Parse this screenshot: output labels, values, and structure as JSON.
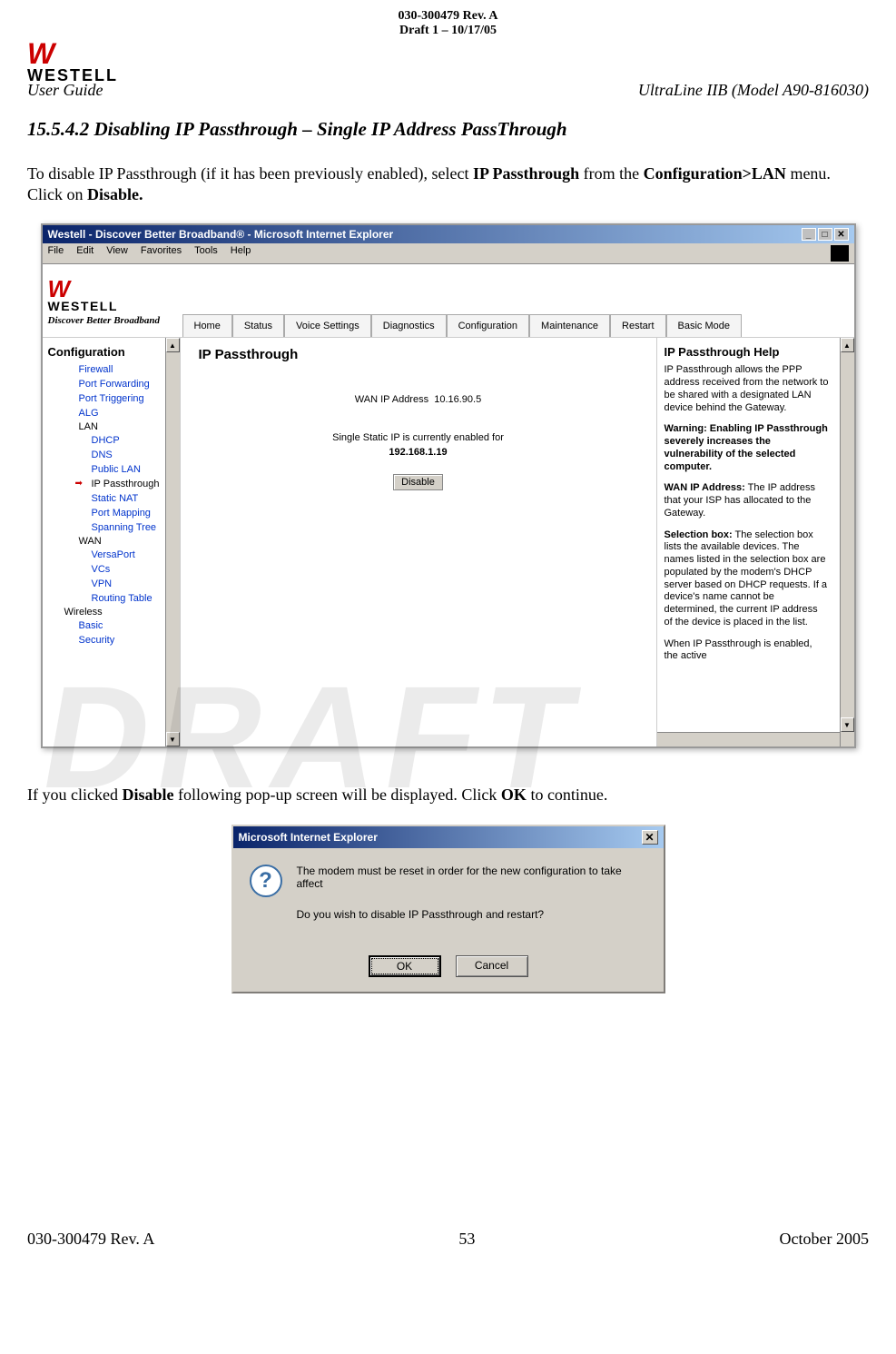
{
  "header": {
    "doc_rev": "030-300479 Rev. A",
    "draft": "Draft 1 – 10/17/05",
    "user_guide": "User Guide",
    "product": "UltraLine IIB (Model A90-816030)",
    "logo_text": "WESTELL"
  },
  "section": {
    "number": "15.5.4.2",
    "title": "Disabling IP Passthrough – Single IP Address PassThrough"
  },
  "para1_a": "To disable IP Passthrough (if it has been previously enabled), select ",
  "para1_b": "IP Passthrough",
  "para1_c": " from the ",
  "para1_d": "Configuration>LAN",
  "para1_e": " menu. Click on ",
  "para1_f": "Disable.",
  "para2_a": "If you clicked ",
  "para2_b": "Disable",
  "para2_c": " following pop-up screen will be displayed. Click ",
  "para2_d": "OK",
  "para2_e": " to continue.",
  "browser": {
    "title": "Westell - Discover Better Broadband® - Microsoft Internet Explorer",
    "menu": [
      "File",
      "Edit",
      "View",
      "Favorites",
      "Tools",
      "Help"
    ],
    "tagline": "Discover Better Broadband",
    "tabs": [
      "Home",
      "Status",
      "Voice Settings",
      "Diagnostics",
      "Configuration",
      "Maintenance",
      "Restart",
      "Basic Mode"
    ],
    "sidebar_title": "Configuration",
    "sidebar": {
      "top": [
        "Firewall",
        "Port Forwarding",
        "Port Triggering",
        "ALG"
      ],
      "lan_label": "LAN",
      "lan": [
        "DHCP",
        "DNS",
        "Public LAN",
        "IP Passthrough",
        "Static NAT",
        "Port Mapping",
        "Spanning Tree"
      ],
      "wan_label": "WAN",
      "wan": [
        "VersaPort",
        "VCs",
        "VPN",
        "Routing Table"
      ],
      "wireless_label": "Wireless",
      "wireless": [
        "Basic",
        "Security"
      ]
    },
    "main": {
      "title": "IP Passthrough",
      "wan_label": "WAN IP Address",
      "wan_value": "10.16.90.5",
      "enabled_line": "Single Static IP is currently enabled for",
      "enabled_ip": "192.168.1.19",
      "disable_btn": "Disable"
    },
    "help": {
      "title": "IP Passthrough Help",
      "p1": "IP Passthrough allows the PPP address received from the network to be shared with a designated LAN device behind the Gateway.",
      "warn_b": "Warning: Enabling IP Passthrough severely increases the vulnerability of the selected computer.",
      "p3_b": "WAN IP Address:",
      "p3": " The IP address that your ISP has allocated to the Gateway.",
      "p4_b": "Selection box:",
      "p4": " The selection box lists the available devices. The names listed in the selection box are populated by the modem's DHCP server based on DHCP requests. If a device's name cannot be determined, the current IP address of the device is placed in the list.",
      "p5": "When IP Passthrough is enabled, the active"
    }
  },
  "dialog": {
    "title": "Microsoft Internet Explorer",
    "line1": "The modem must be reset in order for the new configuration to take affect",
    "line2": "Do you wish to disable IP Passthrough and restart?",
    "ok": "OK",
    "cancel": "Cancel"
  },
  "footer": {
    "left": "030-300479 Rev. A",
    "center": "53",
    "right": "October 2005"
  },
  "watermark": "DRAFT"
}
